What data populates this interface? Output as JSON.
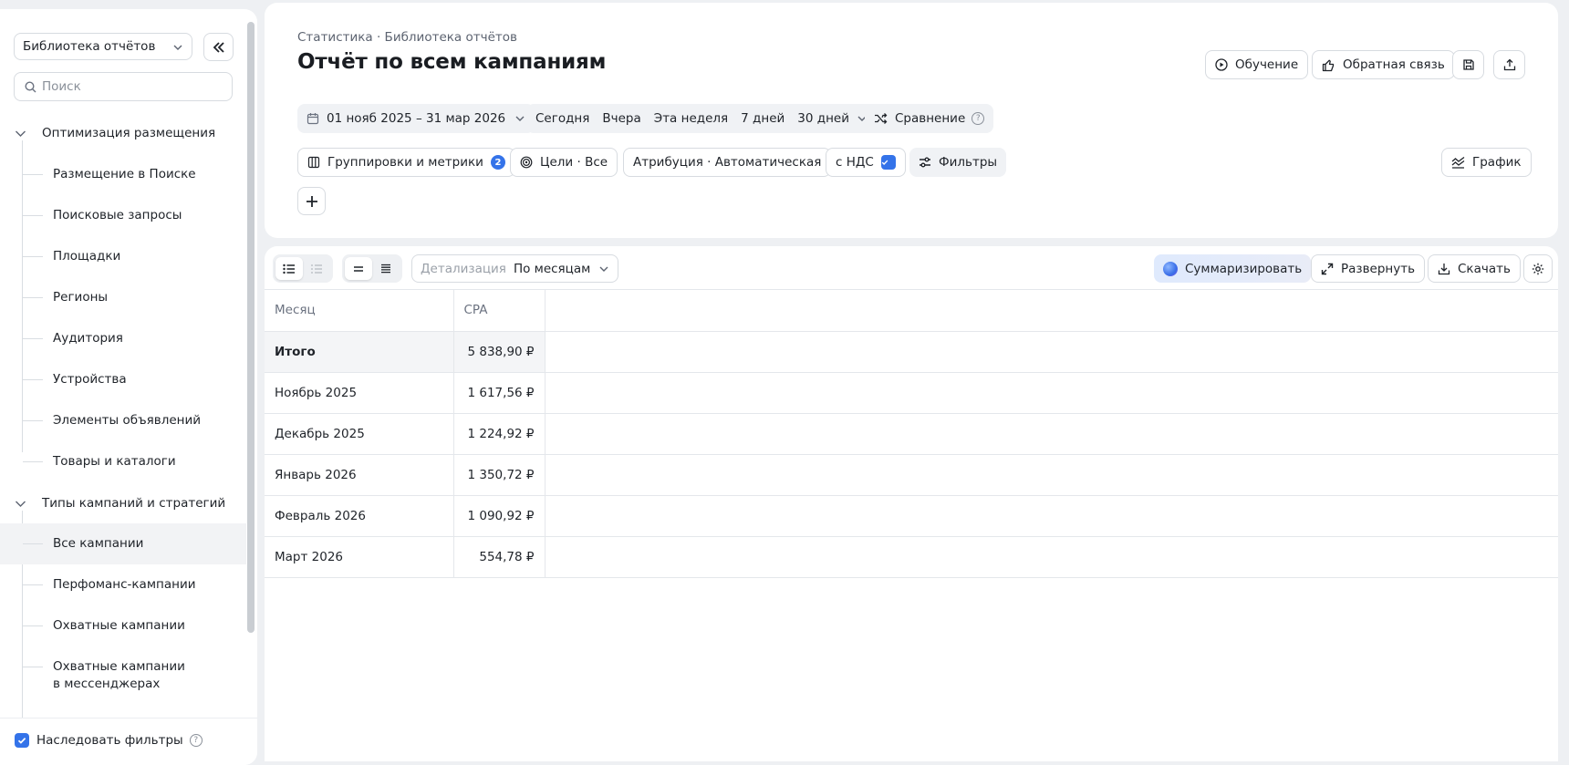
{
  "sidebar": {
    "library_select": "Библиотека отчётов",
    "search_placeholder": "Поиск",
    "groups": [
      {
        "label": "Оптимизация размещения",
        "items": [
          "Размещение в Поиске",
          "Поисковые запросы",
          "Площадки",
          "Регионы",
          "Аудитория",
          "Устройства",
          "Элементы объявлений",
          "Товары и каталоги"
        ]
      },
      {
        "label": "Типы кампаний и стратегий",
        "items": [
          "Все кампании",
          "Перфоманс-кампании",
          "Охватные кампании"
        ],
        "multiline_item": {
          "line1": "Охватные кампании",
          "line2": "в мессенджерах"
        }
      }
    ],
    "active_item": "Все кампании",
    "inherit_filters_label": "Наследовать фильтры",
    "inherit_filters_checked": true
  },
  "header": {
    "breadcrumb": "Статистика · Библиотека отчётов",
    "title": "Отчёт по всем кампаниям",
    "buttons": {
      "learning": "Обучение",
      "feedback": "Обратная связь"
    },
    "date_range": "01 нояб 2025 – 31 мар 2026",
    "periods": [
      "Сегодня",
      "Вчера",
      "Эта неделя",
      "7 дней",
      "30 дней"
    ],
    "comparison": "Сравнение",
    "groupings": "Группировки и метрики",
    "groupings_count": "2",
    "goals": "Цели · Все",
    "attribution": "Атрибуция · Автоматическая",
    "vat": "с НДС",
    "vat_checked": true,
    "filters": "Фильтры",
    "chart": "График"
  },
  "toolbar": {
    "detail_label": "Детализация",
    "detail_value": "По месяцам",
    "summarize": "Суммаризировать",
    "expand": "Развернуть",
    "download": "Скачать"
  },
  "table": {
    "columns": [
      "Месяц",
      "CPA"
    ],
    "total": {
      "label": "Итого",
      "cpa": "5 838,90 ₽"
    },
    "rows": [
      {
        "month": "Ноябрь 2025",
        "cpa": "1 617,56 ₽"
      },
      {
        "month": "Декабрь 2025",
        "cpa": "1 224,92 ₽"
      },
      {
        "month": "Январь 2026",
        "cpa": "1 350,72 ₽"
      },
      {
        "month": "Февраль 2026",
        "cpa": "1 090,92 ₽"
      },
      {
        "month": "Март 2026",
        "cpa": "554,78 ₽"
      }
    ]
  },
  "colors": {
    "accent": "#3473e9",
    "background": "#eef0f3"
  }
}
